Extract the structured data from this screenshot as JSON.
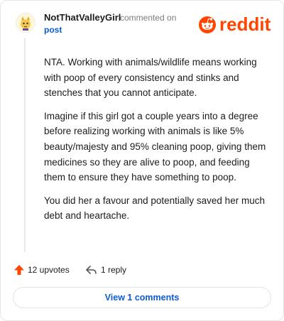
{
  "comment": {
    "username": "NotThatValleyGirl",
    "action_text": "commented on",
    "post_link": "post",
    "paragraphs": [
      "NTA. Working with animals/wildlife means working with poop of every consistency and stinks and stenches that you cannot anticipate.",
      "Imagine if this girl got a couple years into a degree before realizing working with animals is like 5% beauty/majesty and 95% cleaning poop, giving them medicines so they are alive to poop, and feeding them to ensure they have something to poop.",
      "You did her a favour and potentially saved her much debt and heartache."
    ],
    "upvotes_label": "12 upvotes",
    "reply_label": "1 reply",
    "view_comments_label": "View 1 comments"
  },
  "brand": {
    "logo_text": "reddit",
    "accent_color": "#ff4500",
    "link_color": "#0b5bd3"
  },
  "icons": {
    "avatar": "avatar-icon",
    "logo": "reddit-logo-icon",
    "upvote": "upvote-arrow-icon",
    "reply": "reply-arrow-icon"
  }
}
